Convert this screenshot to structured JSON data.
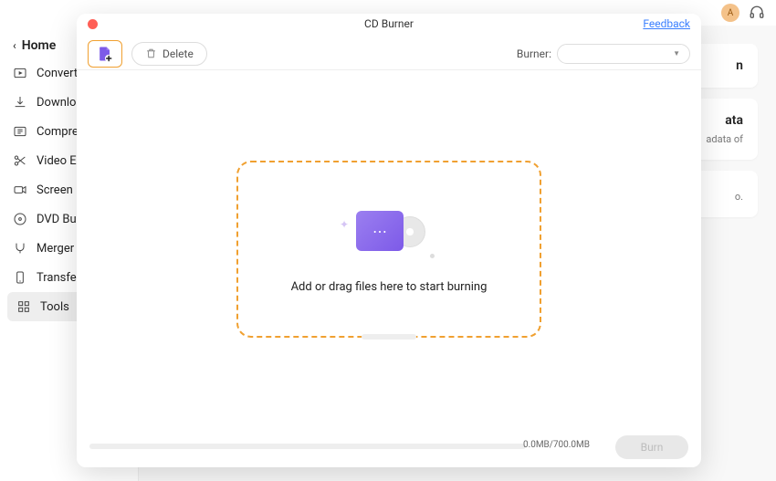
{
  "chrome": {},
  "topbar": {
    "avatar_initial": "A"
  },
  "sidebar": {
    "home": "Home",
    "items": [
      {
        "label": "Converter"
      },
      {
        "label": "Downloader"
      },
      {
        "label": "Compressor"
      },
      {
        "label": "Video Editor"
      },
      {
        "label": "Screen Recorder"
      },
      {
        "label": "DVD Burner"
      },
      {
        "label": "Merger"
      },
      {
        "label": "Transfer"
      },
      {
        "label": "Tools"
      }
    ]
  },
  "background_cards": [
    {
      "title_fragment": "n"
    },
    {
      "title_fragment": "ata",
      "text_fragment": "adata of"
    },
    {
      "text_fragment": "o."
    }
  ],
  "modal": {
    "title": "CD Burner",
    "feedback_label": "Feedback",
    "toolbar": {
      "delete_label": "Delete",
      "burner_label": "Burner:",
      "burner_value": ""
    },
    "dropzone": {
      "text": "Add or drag files here to start burning"
    },
    "footer": {
      "progress_used_mb": 0.0,
      "progress_total_mb": 700.0,
      "progress_label": "0.0MB/700.0MB",
      "burn_label": "Burn"
    }
  }
}
